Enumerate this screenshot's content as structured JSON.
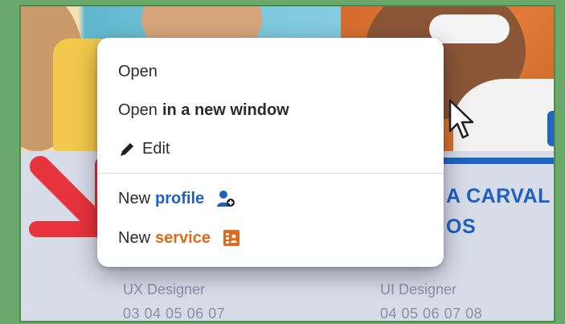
{
  "context_menu": {
    "items": [
      {
        "prefix": "Open",
        "emphasis": ""
      },
      {
        "prefix": "Open",
        "emphasis": "in a new window"
      },
      {
        "prefix": "Edit",
        "emphasis": "",
        "icon": "pencil-icon"
      },
      {
        "prefix": "New",
        "emphasis": "profile",
        "icon": "person-add-icon",
        "accent": "#1f5fbf"
      },
      {
        "prefix": "New",
        "emphasis": "service",
        "icon": "contact-card-icon",
        "accent": "#e06a1c"
      }
    ]
  },
  "cards": [
    {
      "name": "",
      "role": "UX Designer",
      "phone": "03 04 05 06 07"
    },
    {
      "name_line1": "A CARVAL",
      "name_line2": "OS",
      "role": "UI Designer",
      "phone": "04 05 06 07 08"
    }
  ],
  "colors": {
    "brand_blue": "#1f5fbf",
    "accent_orange": "#e06a1c",
    "pointer_red": "#e8323c",
    "card_bg": "#d7dce9"
  }
}
